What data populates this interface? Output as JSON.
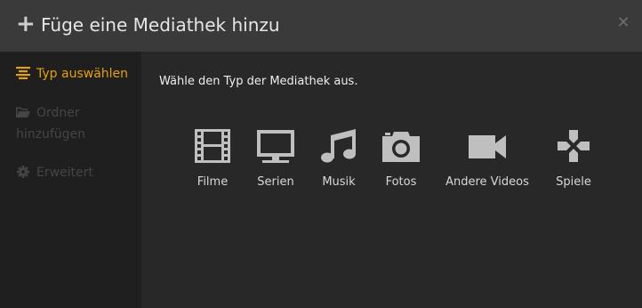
{
  "header": {
    "plus_icon": "plus-icon",
    "title": "Füge eine Mediathek hinzu",
    "close_icon": "close-icon"
  },
  "sidebar": {
    "items": [
      {
        "label": "Typ auswählen",
        "icon": "list-icon",
        "state": "active"
      },
      {
        "label": "Ordner hinzufügen",
        "icon": "folder-icon",
        "state": "disabled"
      },
      {
        "label": "Erweitert",
        "icon": "gear-icon",
        "state": "disabled"
      }
    ]
  },
  "main": {
    "prompt": "Wähle den Typ der Mediathek aus.",
    "types": [
      {
        "label": "Filme",
        "icon": "film-icon"
      },
      {
        "label": "Serien",
        "icon": "tv-icon"
      },
      {
        "label": "Musik",
        "icon": "music-icon"
      },
      {
        "label": "Fotos",
        "icon": "camera-icon"
      },
      {
        "label": "Andere Videos",
        "icon": "video-camera-icon"
      },
      {
        "label": "Spiele",
        "icon": "gamepad-icon"
      }
    ]
  },
  "colors": {
    "accent": "#e5a00d",
    "header_bg": "#3a3a3a",
    "sidebar_bg": "#1f1f1f",
    "content_bg": "#282828",
    "icon": "#bfbfbf"
  }
}
